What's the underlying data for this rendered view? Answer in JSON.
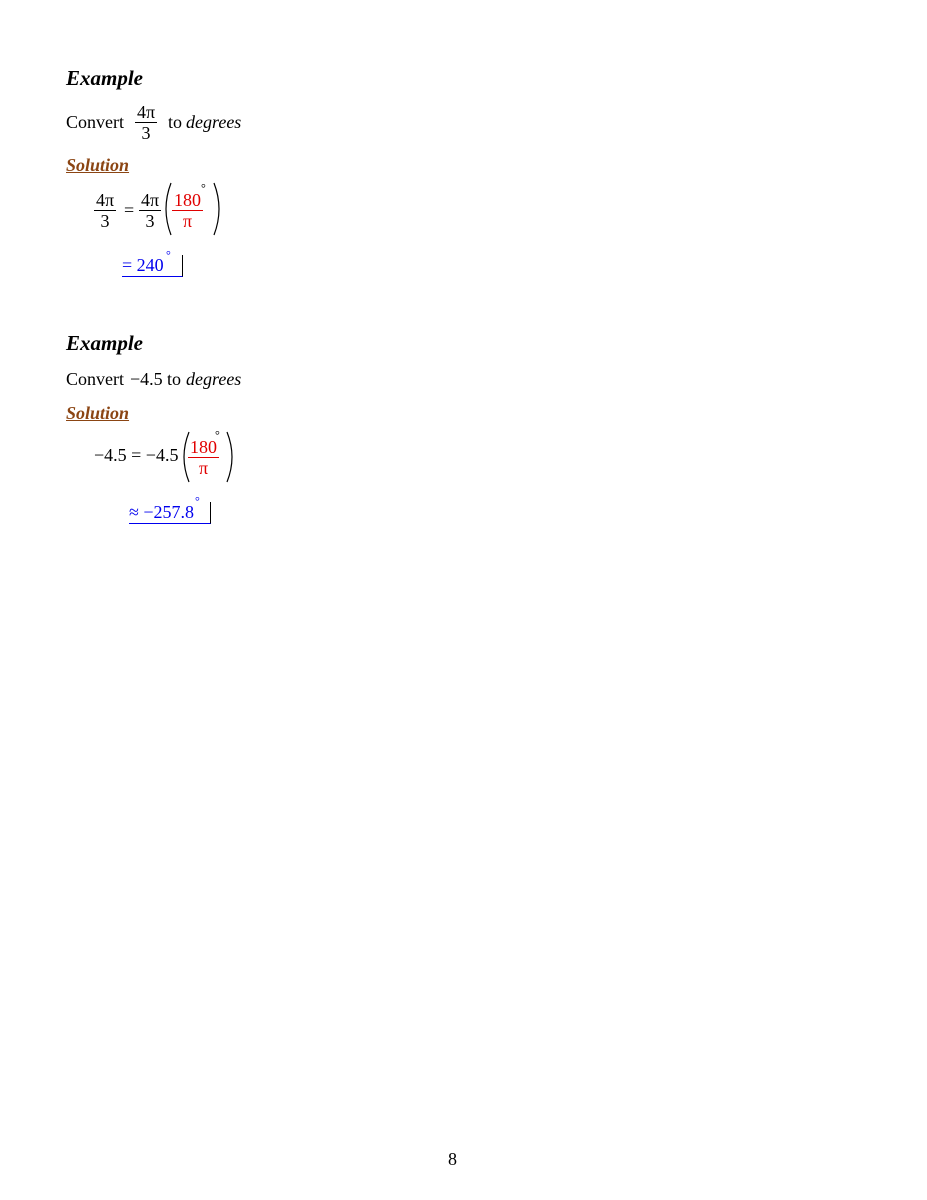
{
  "examples": [
    {
      "heading": "Example",
      "prompt_prefix": "Convert",
      "prompt_num": "4π",
      "prompt_den": "3",
      "prompt_suffix_plain": "to",
      "prompt_suffix_italic": "degrees",
      "solution_label": "Solution",
      "lhs_num": "4π",
      "lhs_den": "3",
      "equals": "=",
      "rhs_num": "4π",
      "rhs_den": "3",
      "factor_num": "180",
      "factor_den": "π",
      "degree_symbol": "°",
      "result": "= 240"
    },
    {
      "heading": "Example",
      "prompt_prefix": "Convert",
      "prompt_value": "−4.5",
      "prompt_suffix_plain": "to",
      "prompt_suffix_italic": "degrees",
      "solution_label": "Solution",
      "lhs": "−4.5 = −4.5",
      "factor_num": "180",
      "factor_den": "π",
      "degree_symbol": "°",
      "result": "≈ −257.8"
    }
  ],
  "page_number": "8",
  "colors": {
    "solution": "#8b4513",
    "highlight": "#e00000",
    "result": "#0000ee"
  }
}
